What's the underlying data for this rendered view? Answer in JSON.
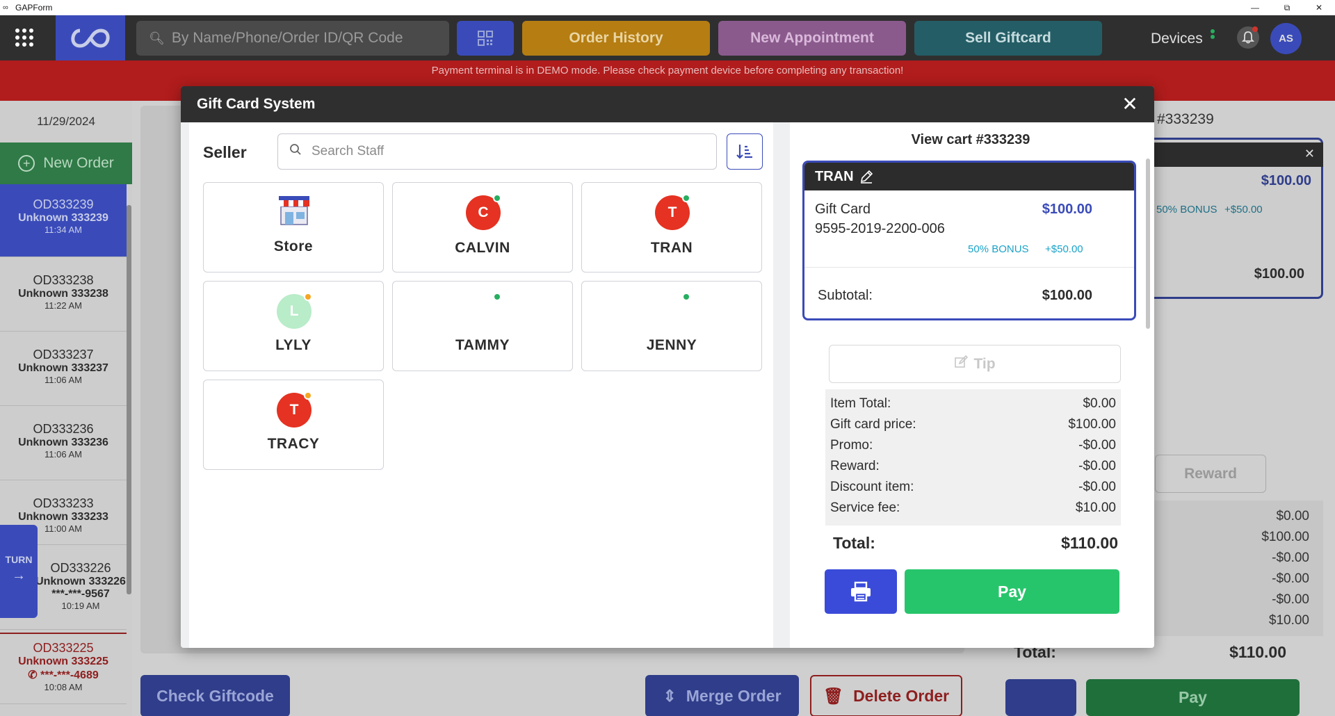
{
  "window": {
    "title": "GAPForm"
  },
  "header": {
    "search_placeholder": "By Name/Phone/Order ID/QR Code",
    "order_history_label": "Order History",
    "new_appointment_label": "New Appointment",
    "sell_giftcard_label": "Sell Giftcard",
    "devices_label": "Devices",
    "user_initials": "AS"
  },
  "banner": {
    "text": "Payment terminal is in DEMO mode. Please check payment device before completing any transaction!"
  },
  "sidebar": {
    "date": "11/29/2024",
    "new_order_label": "New Order",
    "turn_label": "TURN",
    "orders": [
      {
        "id": "OD333239",
        "customer": "Unknown 333239",
        "time": "11:34 AM"
      },
      {
        "id": "OD333238",
        "customer": "Unknown 333238",
        "time": "11:22 AM"
      },
      {
        "id": "OD333237",
        "customer": "Unknown 333237",
        "time": "11:06 AM"
      },
      {
        "id": "OD333236",
        "customer": "Unknown 333236",
        "time": "11:06 AM"
      },
      {
        "id": "OD333233",
        "customer": "Unknown 333233",
        "time": "11:00 AM"
      },
      {
        "id": "OD333226",
        "customer": "Unknown 333226",
        "phone": "***-***-9567",
        "time": "10:19 AM"
      },
      {
        "id": "OD333225",
        "customer": "Unknown 333225",
        "phone": "***-***-4689",
        "time": "10:08 AM"
      }
    ]
  },
  "bottom_bar": {
    "check_giftcode_label": "Check Giftcode",
    "merge_order_label": "Merge Order",
    "delete_order_label": "Delete Order"
  },
  "background_cart": {
    "title": "#333239",
    "price": "$100.00",
    "bonus_label": "50% BONUS",
    "bonus_amount": "+$50.00",
    "subtotal": "$100.00",
    "reward_label": "Reward",
    "summary_values": [
      "$0.00",
      "$100.00",
      "-$0.00",
      "-$0.00",
      "-$0.00",
      "$10.00"
    ],
    "total_label": "Total:",
    "total_value": "$110.00",
    "pay_label": "Pay"
  },
  "modal": {
    "title": "Gift Card System",
    "seller_label": "Seller",
    "staff_search_placeholder": "Search Staff",
    "staff": [
      {
        "name": "Store",
        "initial": "",
        "avatar_color": "",
        "status": ""
      },
      {
        "name": "CALVIN",
        "initial": "C",
        "avatar_color": "#e53222",
        "status": "green"
      },
      {
        "name": "TRAN",
        "initial": "T",
        "avatar_color": "#e53222",
        "status": "green"
      },
      {
        "name": "LYLY",
        "initial": "L",
        "avatar_color": "#b9ecc9",
        "status": "orange"
      },
      {
        "name": "TAMMY",
        "initial": "",
        "avatar_color": "",
        "status": "green"
      },
      {
        "name": "JENNY",
        "initial": "",
        "avatar_color": "",
        "status": "green"
      },
      {
        "name": "TRACY",
        "initial": "T",
        "avatar_color": "#e53222",
        "status": "orange"
      }
    ],
    "cart": {
      "title": "View cart #333239",
      "staff_name": "TRAN",
      "item_name": "Gift Card",
      "item_number": "9595-2019-2200-006",
      "item_price": "$100.00",
      "bonus_label": "50% BONUS",
      "bonus_amount": "+$50.00",
      "subtotal_label": "Subtotal:",
      "subtotal_value": "$100.00",
      "tip_label": "Tip",
      "summary": [
        {
          "label": "Item Total:",
          "value": "$0.00"
        },
        {
          "label": "Gift card price:",
          "value": "$100.00"
        },
        {
          "label": "Promo:",
          "value": "-$0.00"
        },
        {
          "label": "Reward:",
          "value": "-$0.00"
        },
        {
          "label": "Discount item:",
          "value": "-$0.00"
        },
        {
          "label": "Service fee:",
          "value": "$10.00"
        }
      ],
      "total_label": "Total:",
      "total_value": "$110.00",
      "pay_label": "Pay"
    }
  },
  "colors": {
    "brand_blue": "#3a4bb9",
    "pay_green": "#27c56b",
    "danger_red": "#b11c1c",
    "bonus_cyan": "#1aa3c8"
  }
}
